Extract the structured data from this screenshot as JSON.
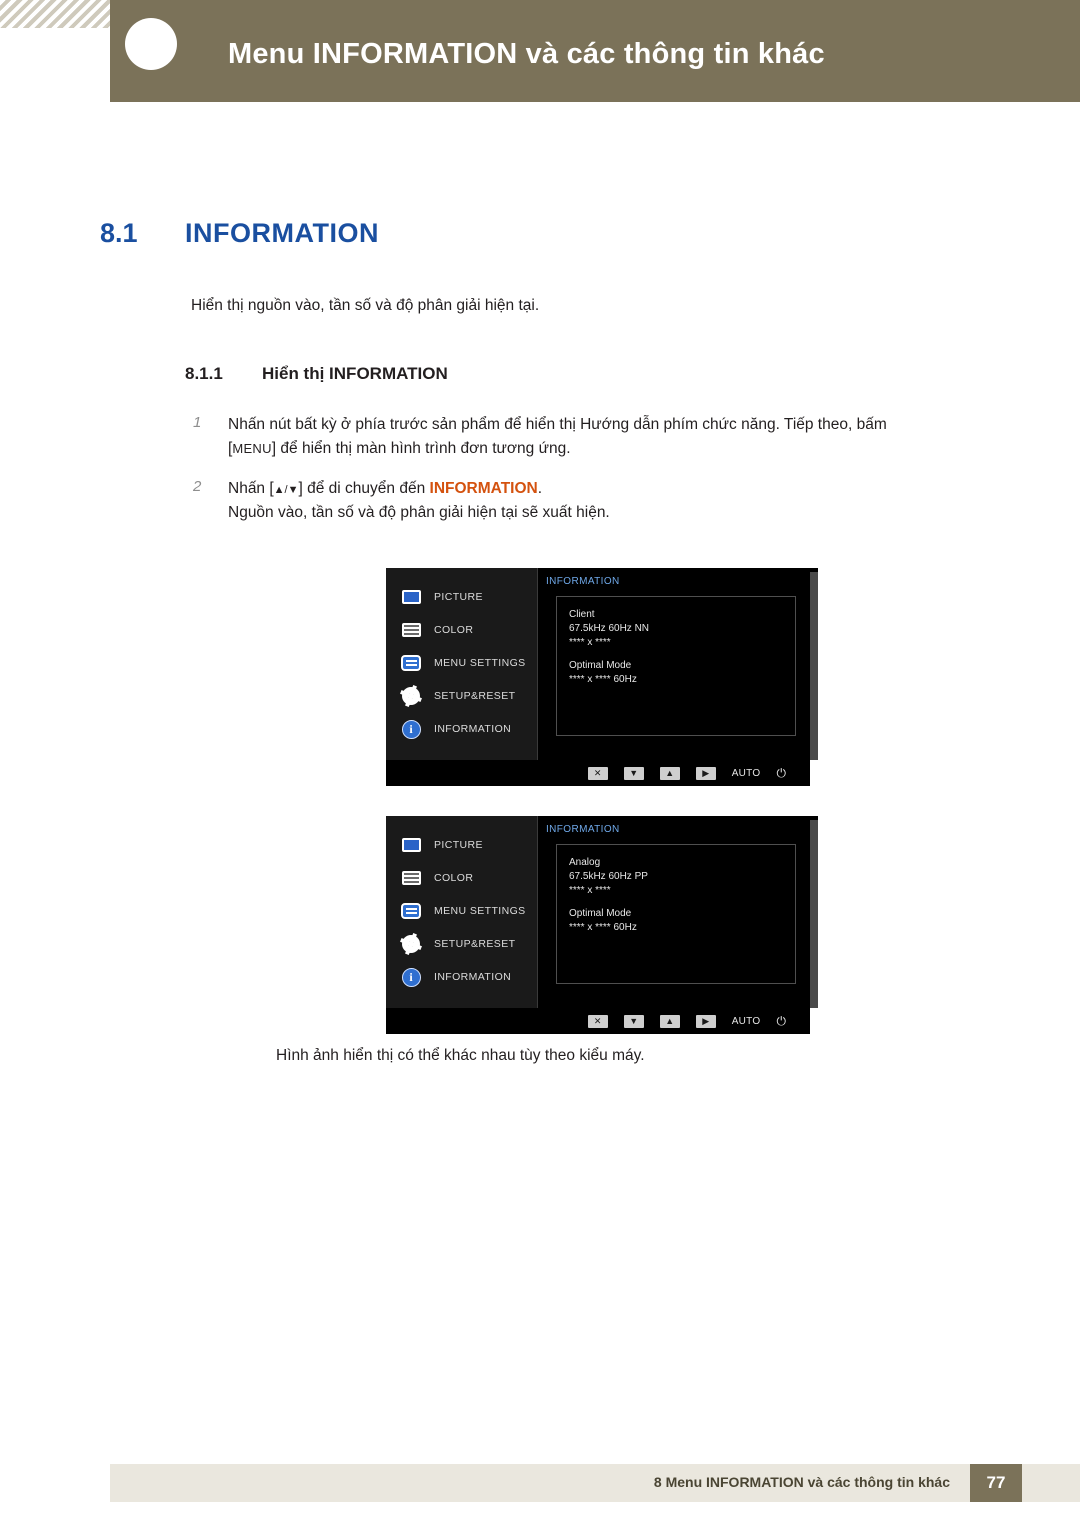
{
  "header": {
    "title": "Menu INFORMATION và các thông tin khác"
  },
  "section": {
    "number": "8.1",
    "title": "INFORMATION",
    "intro": "Hiển thị nguồn vào, tần số và độ phân giải hiện tại.",
    "sub_number": "8.1.1",
    "sub_title": "Hiển thị INFORMATION"
  },
  "steps": [
    {
      "num": "1",
      "line1_a": "Nhấn nút bất kỳ ở phía trước sản phẩm để hiển thị Hướng dẫn phím chức năng. Tiếp theo, bấm",
      "line2_a": "[",
      "line2_key": "MENU",
      "line2_b": "] để hiển thị màn hình trình đơn tương ứng."
    },
    {
      "num": "2",
      "line1_a": "Nhấn [",
      "line1_keys": "▲/▼",
      "line1_b": "] để di chuyển đến ",
      "line1_hl": "INFORMATION",
      "line1_c": ".",
      "line2": "Nguồn vào, tần số và độ phân giải hiện tại sẽ xuất hiện."
    }
  ],
  "osd_menu_items": [
    {
      "icon": "monitor-icon",
      "label": "PICTURE"
    },
    {
      "icon": "sliders-icon",
      "label": "COLOR"
    },
    {
      "icon": "menu-settings-icon",
      "label": "MENU SETTINGS"
    },
    {
      "icon": "gear-icon",
      "label": "SETUP&RESET"
    },
    {
      "icon": "info-icon",
      "label": "INFORMATION"
    }
  ],
  "osd_buttons": {
    "close": "✕",
    "down": "▼",
    "up": "▲",
    "enter": "▶",
    "auto": "AUTO",
    "power": "⏻"
  },
  "osd_screens": [
    {
      "tab_title": "INFORMATION",
      "line_source": "Client",
      "line_freq": "67.5kHz 60Hz NN",
      "line_res": "**** x ****",
      "line_optimal_label": "Optimal Mode",
      "line_optimal_value": "**** x **** 60Hz"
    },
    {
      "tab_title": "INFORMATION",
      "line_source": "Analog",
      "line_freq": "67.5kHz 60Hz PP",
      "line_res": "**** x ****",
      "line_optimal_label": "Optimal Mode",
      "line_optimal_value": "**** x **** 60Hz"
    }
  ],
  "caption": "Hình ảnh hiển thị có thể khác nhau tùy theo kiểu máy.",
  "footer": {
    "text": "8 Menu INFORMATION và các thông tin khác",
    "page": "77"
  }
}
